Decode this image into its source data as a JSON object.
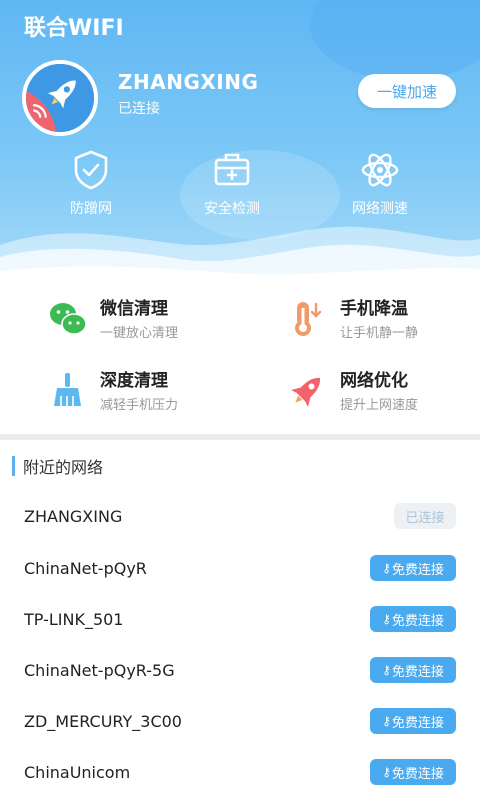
{
  "colors": {
    "primary": "#5ab3f0",
    "header_top": "#5fb7f3",
    "header_bottom": "#a7dbf9",
    "accent_red": "#f0646e"
  },
  "header": {
    "app_title": "联合WIFI",
    "network_name": "ZHANGXING",
    "network_status": "已连接",
    "boost_button": "一键加速",
    "avatar_icon": "rocket-icon",
    "quick_actions": [
      {
        "icon": "shield-check-icon",
        "label": "防蹭网"
      },
      {
        "icon": "toolbox-icon",
        "label": "安全检测"
      },
      {
        "icon": "atom-icon",
        "label": "网络测速"
      }
    ]
  },
  "tools": [
    {
      "icon": "wechat-icon",
      "title": "微信清理",
      "subtitle": "一键放心清理"
    },
    {
      "icon": "thermometer-icon",
      "title": "手机降温",
      "subtitle": "让手机静一静"
    },
    {
      "icon": "broom-icon",
      "title": "深度清理",
      "subtitle": "减轻手机压力"
    },
    {
      "icon": "rocket-icon",
      "title": "网络优化",
      "subtitle": "提升上网速度"
    }
  ],
  "nearby": {
    "title": "附近的网络",
    "networks": [
      {
        "name": "ZHANGXING",
        "action": "已连接",
        "state": "connected"
      },
      {
        "name": "ChinaNet-pQyR",
        "action": "免费连接",
        "state": "free"
      },
      {
        "name": "TP-LINK_501",
        "action": "免费连接",
        "state": "free"
      },
      {
        "name": "ChinaNet-pQyR-5G",
        "action": "免费连接",
        "state": "free"
      },
      {
        "name": "ZD_MERCURY_3C00",
        "action": "免费连接",
        "state": "free"
      },
      {
        "name": "ChinaUnicom",
        "action": "免费连接",
        "state": "free"
      }
    ]
  }
}
